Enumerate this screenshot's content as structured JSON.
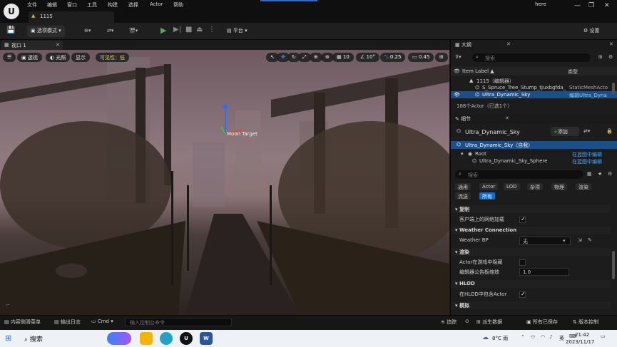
{
  "menubar": {
    "items": [
      "文件",
      "编辑",
      "窗口",
      "工具",
      "构建",
      "选择",
      "Actor",
      "帮助"
    ],
    "project_tab": "1115",
    "search_text": "here"
  },
  "toolbar": {
    "mode": "选项模式",
    "platform": "平台",
    "settings": "设置"
  },
  "viewport": {
    "tab": "视口 1",
    "perspective": "透视",
    "lighting": "光照",
    "show": "显示",
    "visibility": "可见性：低",
    "grid": "10",
    "angle": "10°",
    "scale": "0.25",
    "camera_speed": "0.45",
    "overlay_label": "Moon Target"
  },
  "outliner": {
    "title": "大纲",
    "search_placeholder": "搜索",
    "col_label": "Item Label ▲",
    "col_type": "类型",
    "rows": [
      {
        "label": "1115（编辑器）",
        "type": ""
      },
      {
        "label": "S_Spruce_Tree_Stump_tjuxbgfda_",
        "type": "StaticMeshActo"
      },
      {
        "label": "Ultra_Dynamic_Sky",
        "type": "编辑Ultra_Dyna"
      }
    ],
    "count": "188个Actor（已选1个）"
  },
  "details": {
    "title": "细节",
    "actor_name": "Ultra_Dynamic_Sky",
    "add_label": "添加",
    "self_row": "Ultra_Dynamic_Sky（自我）",
    "root_label": "Root",
    "root_link": "在蓝图中编辑",
    "sphere_label": "Ultra_Dynamic_Sky_Sphere",
    "sphere_link": "在蓝图中编辑",
    "search_placeholder": "搜索",
    "filters_row1": [
      "通用",
      "Actor",
      "LOD",
      "杂项",
      "物理",
      "渲染"
    ],
    "filters_row2": [
      "流送",
      "所有"
    ],
    "sections": [
      {
        "title": "复制",
        "props": [
          {
            "label": "客户端上的网络加载",
            "kind": "check",
            "checked": true
          }
        ]
      },
      {
        "title": "Weather Connection",
        "props": [
          {
            "label": "Weather BP",
            "kind": "combo",
            "value": "无"
          }
        ]
      },
      {
        "title": "渲染",
        "props": [
          {
            "label": "Actor在游戏中隐藏",
            "kind": "check",
            "checked": false
          },
          {
            "label": "编辑器公告板缩放",
            "kind": "number",
            "value": "1.0"
          }
        ]
      },
      {
        "title": "HLOD",
        "props": [
          {
            "label": "在HLOD中包含Actor",
            "kind": "check",
            "checked": true
          }
        ]
      },
      {
        "title": "模拟",
        "props": []
      }
    ]
  },
  "statusbar": {
    "content_drawer": "内容侧滑菜单",
    "output_log": "输出日志",
    "cmd": "Cmd",
    "cmd_placeholder": "输入控制台命令",
    "trace": "追踪",
    "derived_data": "派生数据",
    "saved": "所有已保存",
    "version_control": "版本控制"
  },
  "taskbar": {
    "search": "搜索",
    "weather": "8°C 雨",
    "ime": "英",
    "time": "21:42",
    "date": "2023/11/17"
  },
  "colors": {
    "accent": "#0a6fd1",
    "selection": "#1c4f88",
    "play_green": "#4caf50"
  }
}
